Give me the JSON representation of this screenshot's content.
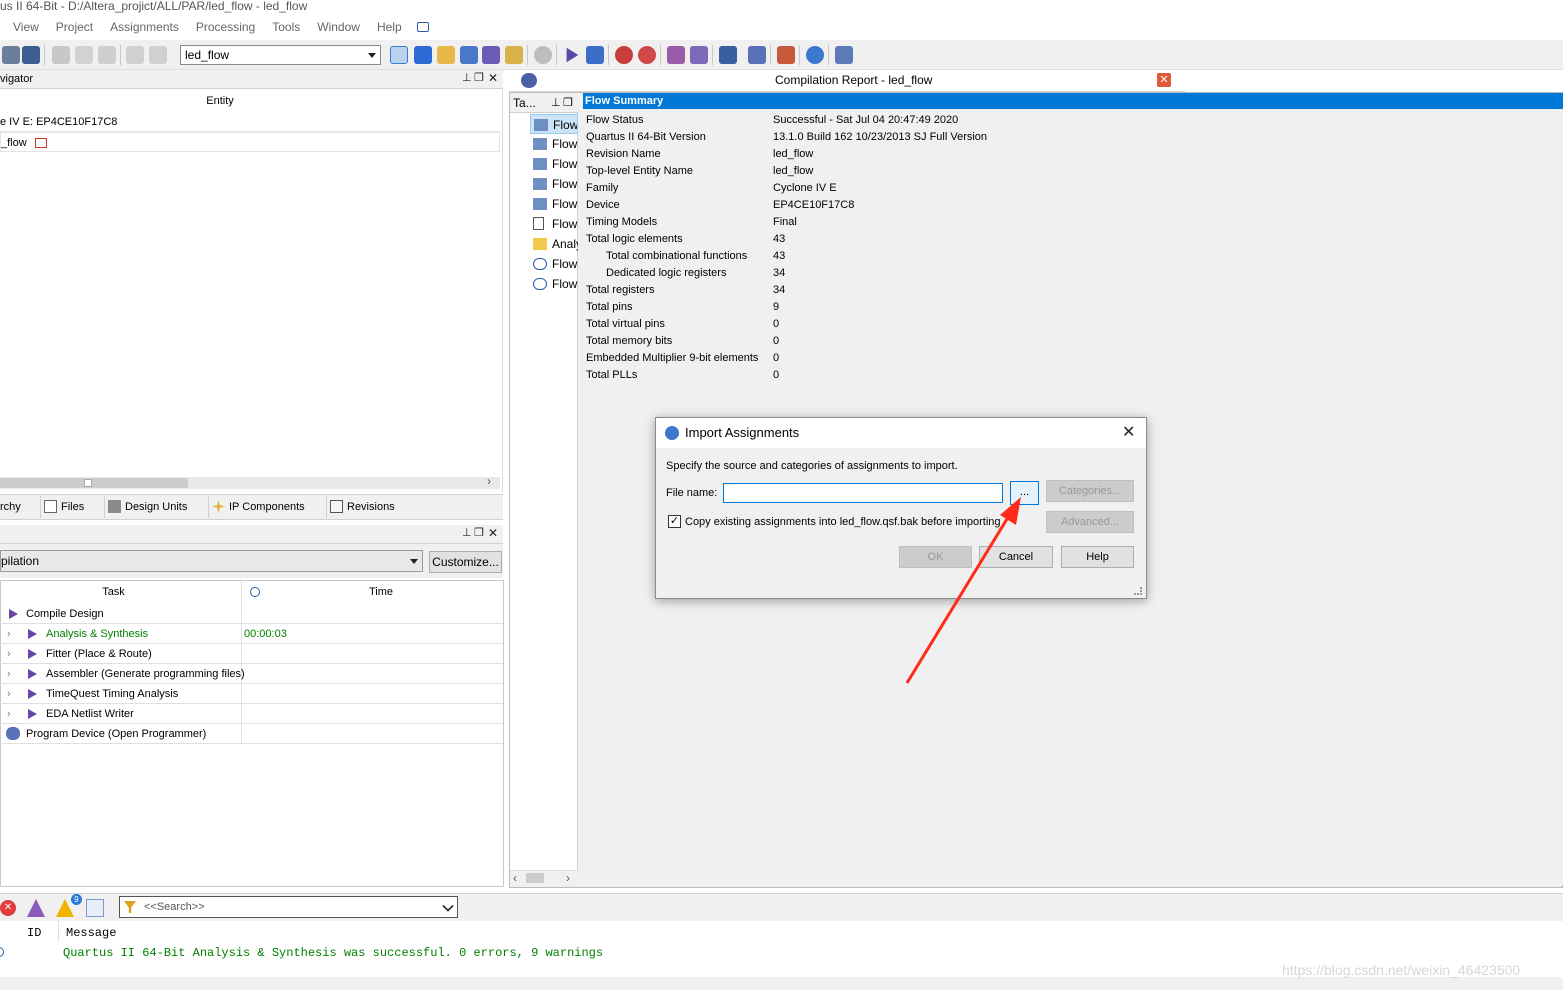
{
  "window": {
    "title": "us II 64-Bit - D:/Altera_projict/ALL/PAR/led_flow - led_flow"
  },
  "menu": [
    "View",
    "Project",
    "Assignments",
    "Processing",
    "Tools",
    "Window",
    "Help"
  ],
  "toolbar": {
    "revision": "led_flow"
  },
  "navigator": {
    "title": "vigator",
    "column_entity": "Entity",
    "rows": [
      "e IV E: EP4CE10F17C8",
      "_flow"
    ],
    "tabs": [
      "rchy",
      "Files",
      "Design Units",
      "IP Components",
      "Revisions"
    ]
  },
  "tasks": {
    "flow_select": "pilation",
    "customize_label": "Customize...",
    "col_task": "Task",
    "col_time": "Time",
    "rows": [
      {
        "name": "Compile Design",
        "time": ""
      },
      {
        "name": "Analysis & Synthesis",
        "time": "00:00:03"
      },
      {
        "name": "Fitter (Place & Route)",
        "time": ""
      },
      {
        "name": "Assembler (Generate programming files)",
        "time": ""
      },
      {
        "name": "TimeQuest Timing Analysis",
        "time": ""
      },
      {
        "name": "EDA Netlist Writer",
        "time": ""
      },
      {
        "name": "Program Device (Open Programmer)",
        "time": ""
      }
    ]
  },
  "report": {
    "tab_title": "Compilation Report - led_flow",
    "toc_header": "Ta...",
    "toc_items": [
      "Flow",
      "Flow",
      "Flow",
      "Flow",
      "Flow",
      "Flow",
      "Analy",
      "Flow",
      "Flow"
    ],
    "section": "Flow Summary",
    "rows": [
      {
        "label": "Flow Status",
        "value": "Successful - Sat Jul 04 20:47:49 2020",
        "indent": false
      },
      {
        "label": "Quartus II 64-Bit Version",
        "value": "13.1.0 Build 162 10/23/2013 SJ Full Version",
        "indent": false
      },
      {
        "label": "Revision Name",
        "value": "led_flow",
        "indent": false
      },
      {
        "label": "Top-level Entity Name",
        "value": "led_flow",
        "indent": false
      },
      {
        "label": "Family",
        "value": "Cyclone IV E",
        "indent": false
      },
      {
        "label": "Device",
        "value": "EP4CE10F17C8",
        "indent": false
      },
      {
        "label": "Timing Models",
        "value": "Final",
        "indent": false
      },
      {
        "label": "Total logic elements",
        "value": "43",
        "indent": false
      },
      {
        "label": "Total combinational functions",
        "value": "43",
        "indent": true
      },
      {
        "label": "Dedicated logic registers",
        "value": "34",
        "indent": true
      },
      {
        "label": "Total registers",
        "value": "34",
        "indent": false
      },
      {
        "label": "Total pins",
        "value": "9",
        "indent": false
      },
      {
        "label": "Total virtual pins",
        "value": "0",
        "indent": false
      },
      {
        "label": "Total memory bits",
        "value": "0",
        "indent": false
      },
      {
        "label": "Embedded Multiplier 9-bit elements",
        "value": "0",
        "indent": false
      },
      {
        "label": "Total PLLs",
        "value": "0",
        "indent": false
      }
    ]
  },
  "dialog": {
    "title": "Import Assignments",
    "instruction": "Specify the source and categories of assignments to import.",
    "file_label": "File name:",
    "file_value": "",
    "browse_label": "...",
    "categories_label": "Categories...",
    "advanced_label": "Advanced...",
    "checkbox_label": "Copy existing assignments into led_flow.qsf.bak before importing",
    "checkbox_checked": true,
    "ok_label": "OK",
    "cancel_label": "Cancel",
    "help_label": "Help"
  },
  "messages": {
    "warning_count": "9",
    "search_placeholder": "<<Search>>",
    "col_id": "ID",
    "col_message": "Message",
    "line": "Quartus II 64-Bit Analysis & Synthesis was successful. 0 errors, 9 warnings"
  },
  "watermark": "https://blog.csdn.net/weixin_46423500",
  "colors": {
    "accent": "#0078d7",
    "success": "#008000",
    "arrow": "#ff2a1a"
  }
}
